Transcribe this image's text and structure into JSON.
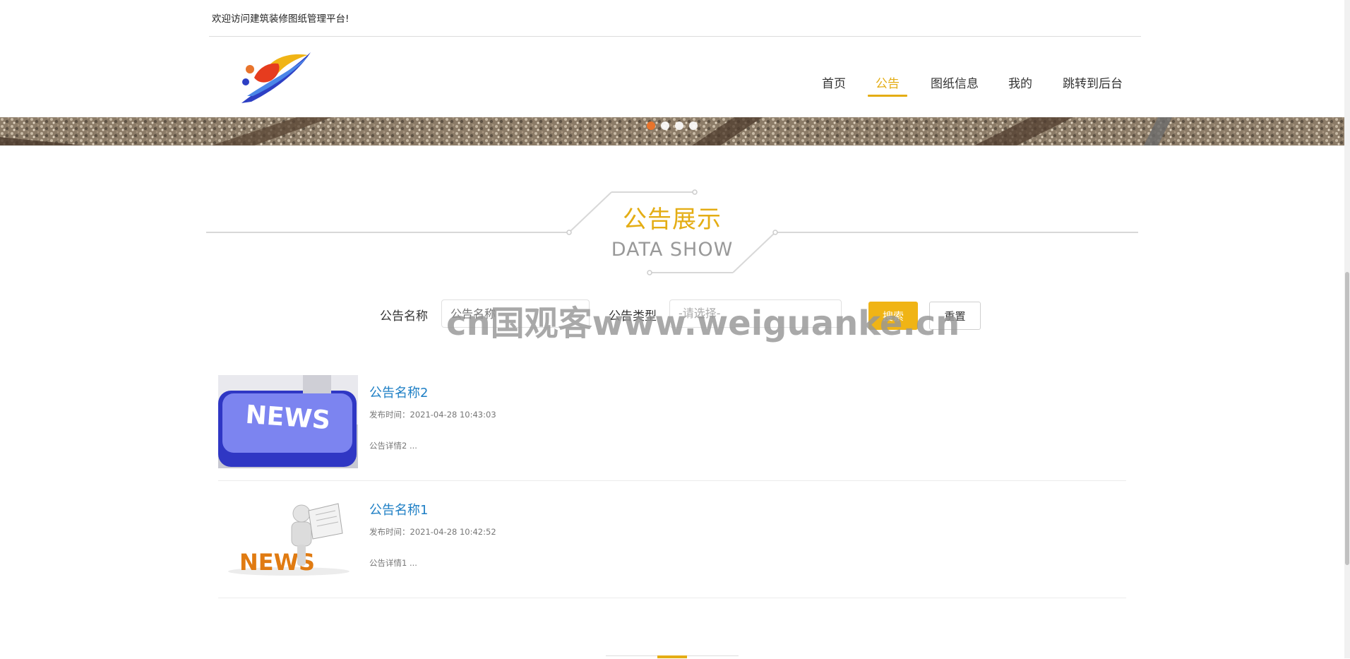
{
  "header": {
    "welcome_text": "欢迎访问建筑装修图纸管理平台!"
  },
  "nav": {
    "items": [
      {
        "label": "首页",
        "active": false
      },
      {
        "label": "公告",
        "active": true
      },
      {
        "label": "图纸信息",
        "active": false
      },
      {
        "label": "我的",
        "active": false
      },
      {
        "label": "跳转到后台",
        "active": false
      }
    ]
  },
  "banner": {
    "slide_count": 4,
    "active_index": 0
  },
  "section": {
    "title": "公告展示",
    "subtitle": "DATA SHOW"
  },
  "search": {
    "name_label": "公告名称",
    "name_placeholder": "公告名称",
    "type_label": "公告类型",
    "type_placeholder": "-请选择-",
    "search_button": "搜索",
    "reset_button": "重置"
  },
  "watermark": "cn国观客www.weiguanke.cn",
  "notices": [
    {
      "title": "公告名称2",
      "time": "发布时间：2021-04-28 10:43:03",
      "desc": "公告详情2 ...",
      "image_icon": "news-keyboard-image"
    },
    {
      "title": "公告名称1",
      "time": "发布时间：2021-04-28 10:42:52",
      "desc": "公告详情1 ...",
      "image_icon": "news-reader-image"
    }
  ],
  "colors": {
    "accent": "#e4ad14",
    "link": "#1e7fc5",
    "dot_active": "#e8742c"
  }
}
